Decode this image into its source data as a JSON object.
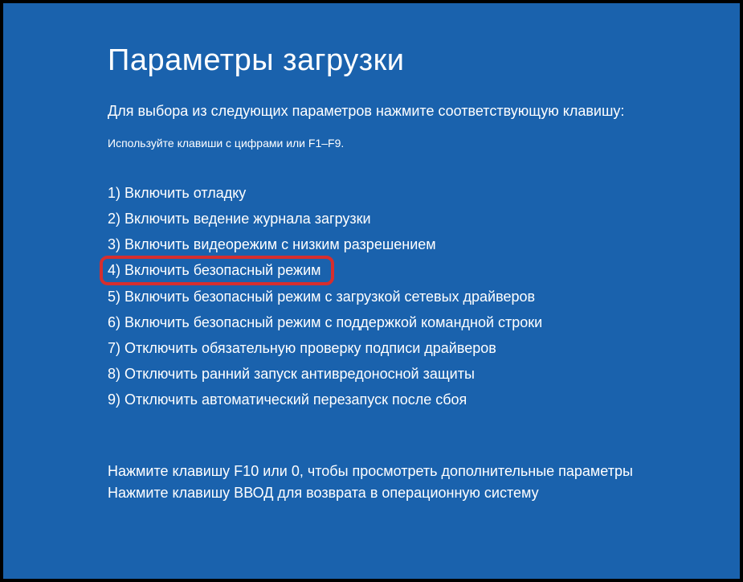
{
  "title": "Параметры загрузки",
  "instruction": "Для выбора из следующих параметров нажмите соответствующую клавишу:",
  "hint": "Используйте клавиши с цифрами или F1–F9.",
  "options": [
    "1) Включить отладку",
    "2) Включить ведение журнала загрузки",
    "3) Включить видеорежим с низким разрешением",
    "4) Включить безопасный режим",
    "5) Включить безопасный режим с загрузкой сетевых драйверов",
    "6) Включить безопасный режим с поддержкой командной строки",
    "7) Отключить обязательную проверку подписи драйверов",
    "8) Отключить ранний запуск антивредоносной защиты",
    "9) Отключить автоматический перезапуск после сбоя"
  ],
  "highlighted_index": 3,
  "footer": {
    "line1": "Нажмите клавишу F10 или 0, чтобы просмотреть дополнительные параметры",
    "line2": "Нажмите клавишу ВВОД для возврата в операционную систему"
  }
}
